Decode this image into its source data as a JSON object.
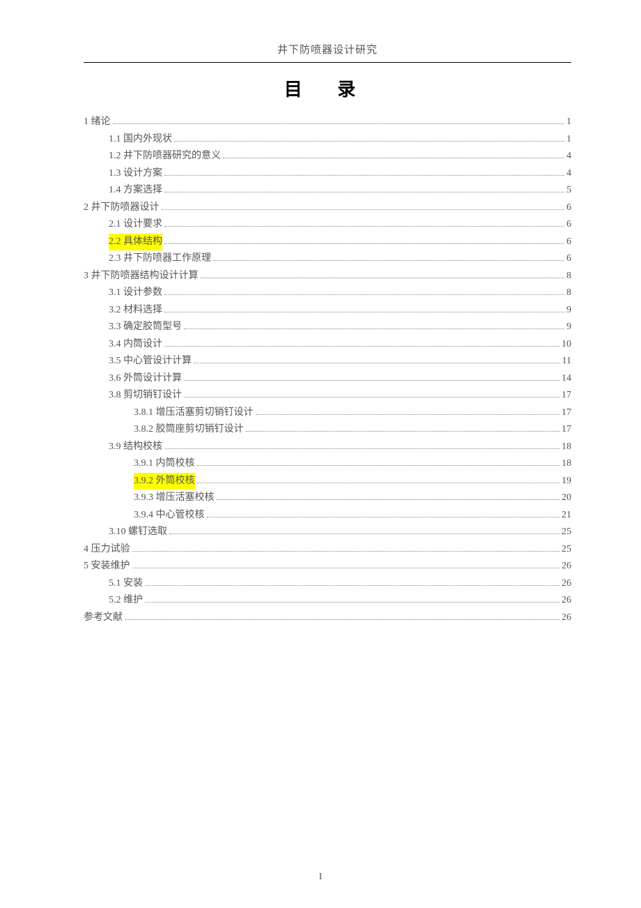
{
  "header": "井下防喷器设计研究",
  "toc_title": "目  录",
  "page_number": "I",
  "entries": [
    {
      "level": 0,
      "text": "1 绪论",
      "page": "1",
      "highlight": false
    },
    {
      "level": 1,
      "text": "1.1 国内外现状",
      "page": "1",
      "highlight": false
    },
    {
      "level": 1,
      "text": "1.2 井下防喷器研究的意义",
      "page": "4",
      "highlight": false
    },
    {
      "level": 1,
      "text": "1.3 设计方案",
      "page": "4",
      "highlight": false
    },
    {
      "level": 1,
      "text": "1.4 方案选择",
      "page": "5",
      "highlight": false
    },
    {
      "level": 0,
      "text": "2 井下防喷器设计",
      "page": "6",
      "highlight": false
    },
    {
      "level": 1,
      "text": "2.1 设计要求",
      "page": "6",
      "highlight": false
    },
    {
      "level": 1,
      "text": "2.2 具体结构",
      "page": "6",
      "highlight": true
    },
    {
      "level": 1,
      "text": "2.3 井下防喷器工作原理",
      "page": "6",
      "highlight": false
    },
    {
      "level": 0,
      "text": "3 井下防喷器结构设计计算",
      "page": "8",
      "highlight": false
    },
    {
      "level": 1,
      "text": "3.1 设计参数",
      "page": "8",
      "highlight": false
    },
    {
      "level": 1,
      "text": "3.2 材料选择",
      "page": "9",
      "highlight": false
    },
    {
      "level": 1,
      "text": "3.3 确定胶筒型号",
      "page": "9",
      "highlight": false
    },
    {
      "level": 1,
      "text": "3.4 内筒设计",
      "page": "10",
      "highlight": false
    },
    {
      "level": 1,
      "text": "3.5 中心管设计计算",
      "page": "11",
      "highlight": false
    },
    {
      "level": 1,
      "text": "3.6 外筒设计计算",
      "page": "14",
      "highlight": false
    },
    {
      "level": 1,
      "text": "3.8 剪切销钉设计",
      "page": "17",
      "highlight": false
    },
    {
      "level": 2,
      "text": "3.8.1 增压活塞剪切销钉设计",
      "page": "17",
      "highlight": false
    },
    {
      "level": 2,
      "text": "3.8.2 胶筒座剪切销钉设计",
      "page": "17",
      "highlight": false
    },
    {
      "level": 1,
      "text": "3.9 结构校核",
      "page": "18",
      "highlight": false
    },
    {
      "level": 2,
      "text": "3.9.1 内筒校核",
      "page": "18",
      "highlight": false
    },
    {
      "level": 2,
      "text": "3.9.2 外筒校核",
      "page": "19",
      "highlight": true
    },
    {
      "level": 2,
      "text": "3.9.3 增压活塞校核",
      "page": "20",
      "highlight": false
    },
    {
      "level": 2,
      "text": "3.9.4 中心管校核",
      "page": "21",
      "highlight": false
    },
    {
      "level": 1,
      "text": "3.10 螺钉选取",
      "page": "25",
      "highlight": false
    },
    {
      "level": 0,
      "text": "4 压力试验",
      "page": "25",
      "highlight": false
    },
    {
      "level": 0,
      "text": "5 安装维护",
      "page": "26",
      "highlight": false
    },
    {
      "level": 1,
      "text": "5.1 安装",
      "page": "26",
      "highlight": false
    },
    {
      "level": 1,
      "text": "5.2 维护",
      "page": "26",
      "highlight": false
    },
    {
      "level": 0,
      "text": "参考文献",
      "page": "26",
      "highlight": false
    }
  ]
}
